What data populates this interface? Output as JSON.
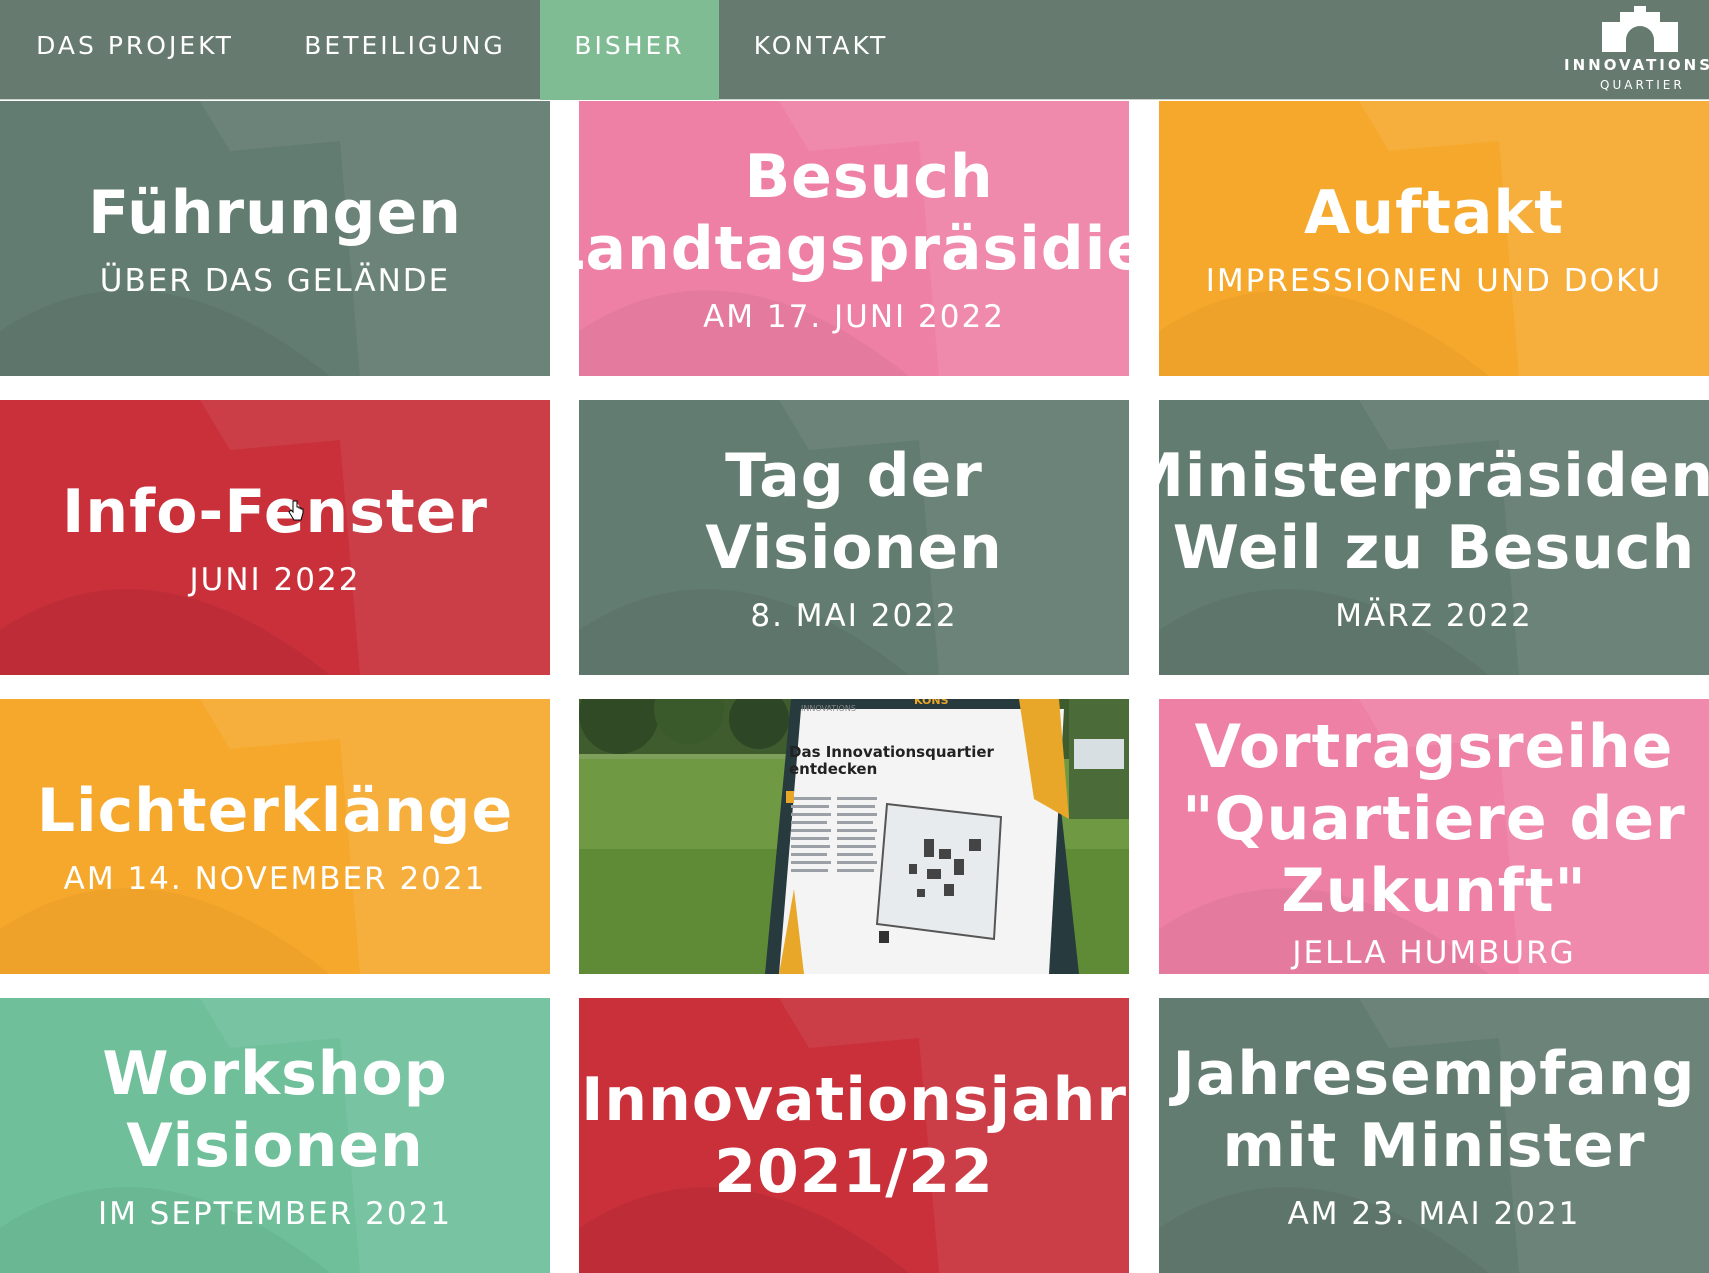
{
  "nav": {
    "items": [
      {
        "label": "DAS PROJEKT"
      },
      {
        "label": "BETEILIGUNG"
      },
      {
        "label": "BISHER",
        "active": true
      },
      {
        "label": "KONTAKT"
      }
    ],
    "active_color": "#80bc93",
    "bar_color": "#667a6f"
  },
  "logo": {
    "title": "INNOVATIONS",
    "subtitle": "QUARTIER",
    "icon": "building-logo-icon"
  },
  "colors": {
    "green_grey": "#637c71",
    "pink": "#ee80a6",
    "orange": "#f6a82c",
    "red": "#c9303a",
    "mint": "#6ebf9a"
  },
  "tiles": [
    {
      "title": "Führungen",
      "subtitle": "ÜBER DAS GELÄNDE",
      "color": "green_grey"
    },
    {
      "title": "Besuch\nLandtagspräsidien",
      "subtitle": "AM 17. JUNI 2022",
      "color": "pink"
    },
    {
      "title": "Auftakt",
      "subtitle": "IMPRESSIONEN UND DOKU",
      "color": "orange"
    },
    {
      "title": "Info-Fenster",
      "subtitle": "JUNI 2022",
      "color": "red"
    },
    {
      "title": "Tag der Visionen",
      "subtitle": "8. MAI 2022",
      "color": "green_grey"
    },
    {
      "title": "Ministerpräsident\nWeil zu Besuch",
      "subtitle": "MÄRZ 2022",
      "color": "green_grey"
    },
    {
      "title": "Lichterklänge",
      "subtitle": "AM 14. NOVEMBER 2021",
      "color": "orange"
    },
    {
      "photo": true,
      "sign_heading": "Das Innovationsquartier\nentdecken",
      "sign_top": "INNOVATIONS",
      "sign_top_right": "KONS"
    },
    {
      "title": "Vortragsreihe\n\"Quartiere der\nZukunft\"",
      "subtitle": "JELLA HUMBURG",
      "color": "pink"
    },
    {
      "title": "Workshop\nVisionen",
      "subtitle": "IM SEPTEMBER 2021",
      "color": "mint"
    },
    {
      "title": "Innovationsjahr\n2021/22",
      "subtitle": "",
      "color": "red"
    },
    {
      "title": "Jahresempfang\nmit Minister",
      "subtitle": "AM 23. MAI 2021",
      "color": "green_grey"
    }
  ]
}
